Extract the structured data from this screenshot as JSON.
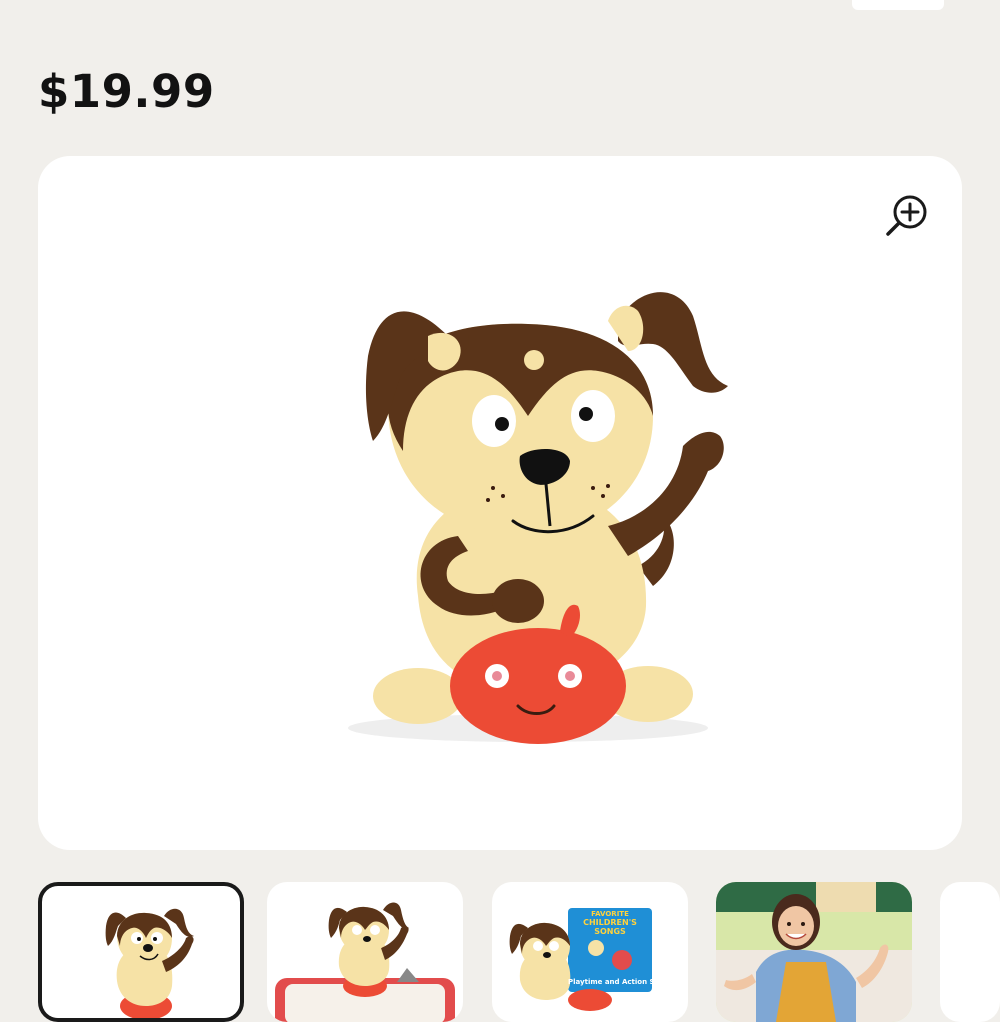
{
  "product": {
    "price": "$19.99"
  },
  "gallery": {
    "zoom_icon": "zoom-in-icon",
    "thumbnails": [
      {
        "image": "dog-figurine-front",
        "selected": true
      },
      {
        "image": "dog-figurine-on-speaker-box",
        "selected": false
      },
      {
        "image": "dog-figurine-with-songs-album",
        "selected": false
      },
      {
        "image": "girl-dancing-photo",
        "selected": false
      }
    ],
    "album_cover_text": {
      "line1": "FAVORITE",
      "line2": "CHILDREN'S SONGS",
      "line3": "Playtime and Action Songs"
    }
  },
  "colors": {
    "background": "#f1efeb",
    "card": "#ffffff",
    "text": "#121212",
    "dog_brown": "#5a3419",
    "dog_cream": "#f6e2a6",
    "ball_red": "#ec4b35"
  }
}
